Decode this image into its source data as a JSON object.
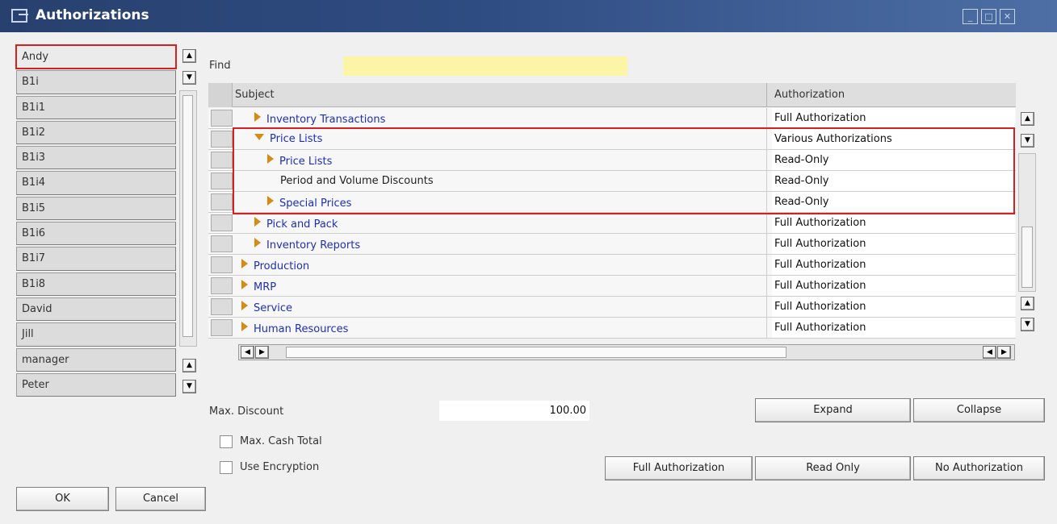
{
  "window": {
    "title": "Authorizations",
    "min_glyph": "_",
    "max_glyph": "□",
    "close_glyph": "✕"
  },
  "users": [
    "Andy",
    "B1i",
    "B1i1",
    "B1i2",
    "B1i3",
    "B1i4",
    "B1i5",
    "B1i6",
    "B1i7",
    "B1i8",
    "David",
    "Jill",
    "manager",
    "Peter"
  ],
  "selected_user": "Andy",
  "find": {
    "label": "Find",
    "value": ""
  },
  "grid": {
    "columns": [
      "Subject",
      "Authorization"
    ],
    "rows": [
      {
        "subject": "Inventory Transactions",
        "authorization": "Full Authorization",
        "expander": "collapsed"
      },
      {
        "subject": "Price Lists",
        "authorization": "Various Authorizations",
        "expander": "expanded"
      },
      {
        "subject": "Price Lists",
        "authorization": "Read-Only",
        "expander": "collapsed"
      },
      {
        "subject": "Period and Volume Discounts",
        "authorization": "Read-Only",
        "expander": "none"
      },
      {
        "subject": "Special Prices",
        "authorization": "Read-Only",
        "expander": "collapsed"
      },
      {
        "subject": "Pick and Pack",
        "authorization": "Full Authorization",
        "expander": "collapsed"
      },
      {
        "subject": "Inventory Reports",
        "authorization": "Full Authorization",
        "expander": "collapsed"
      },
      {
        "subject": "Production",
        "authorization": "Full Authorization",
        "expander": "collapsed"
      },
      {
        "subject": "MRP",
        "authorization": "Full Authorization",
        "expander": "collapsed"
      },
      {
        "subject": "Service",
        "authorization": "Full Authorization",
        "expander": "collapsed"
      },
      {
        "subject": "Human Resources",
        "authorization": "Full Authorization",
        "expander": "collapsed"
      }
    ]
  },
  "max_discount": {
    "label": "Max. Discount",
    "value": "100.00"
  },
  "max_cash_total": {
    "label": "Max. Cash Total",
    "checked": false
  },
  "use_encryption": {
    "label": "Use Encryption",
    "checked": false
  },
  "buttons": {
    "expand": "Expand",
    "collapse": "Collapse",
    "full_authorization": "Full Authorization",
    "read_only": "Read Only",
    "no_authorization": "No Authorization",
    "ok": "OK",
    "cancel": "Cancel"
  },
  "colors": {
    "title_bar": "#2f4c82",
    "find_field": "#fdf5a6",
    "highlight": "#d42020",
    "link_text": "#1e2fb5",
    "expander": "#d58b14"
  },
  "icons": {
    "window": "window-icon",
    "scroll_up": "arrow-up-icon",
    "scroll_down": "arrow-down-icon",
    "scroll_left": "arrow-left-icon",
    "scroll_right": "arrow-right-icon",
    "collapsed": "triangle-right-icon",
    "expanded": "triangle-down-icon"
  }
}
